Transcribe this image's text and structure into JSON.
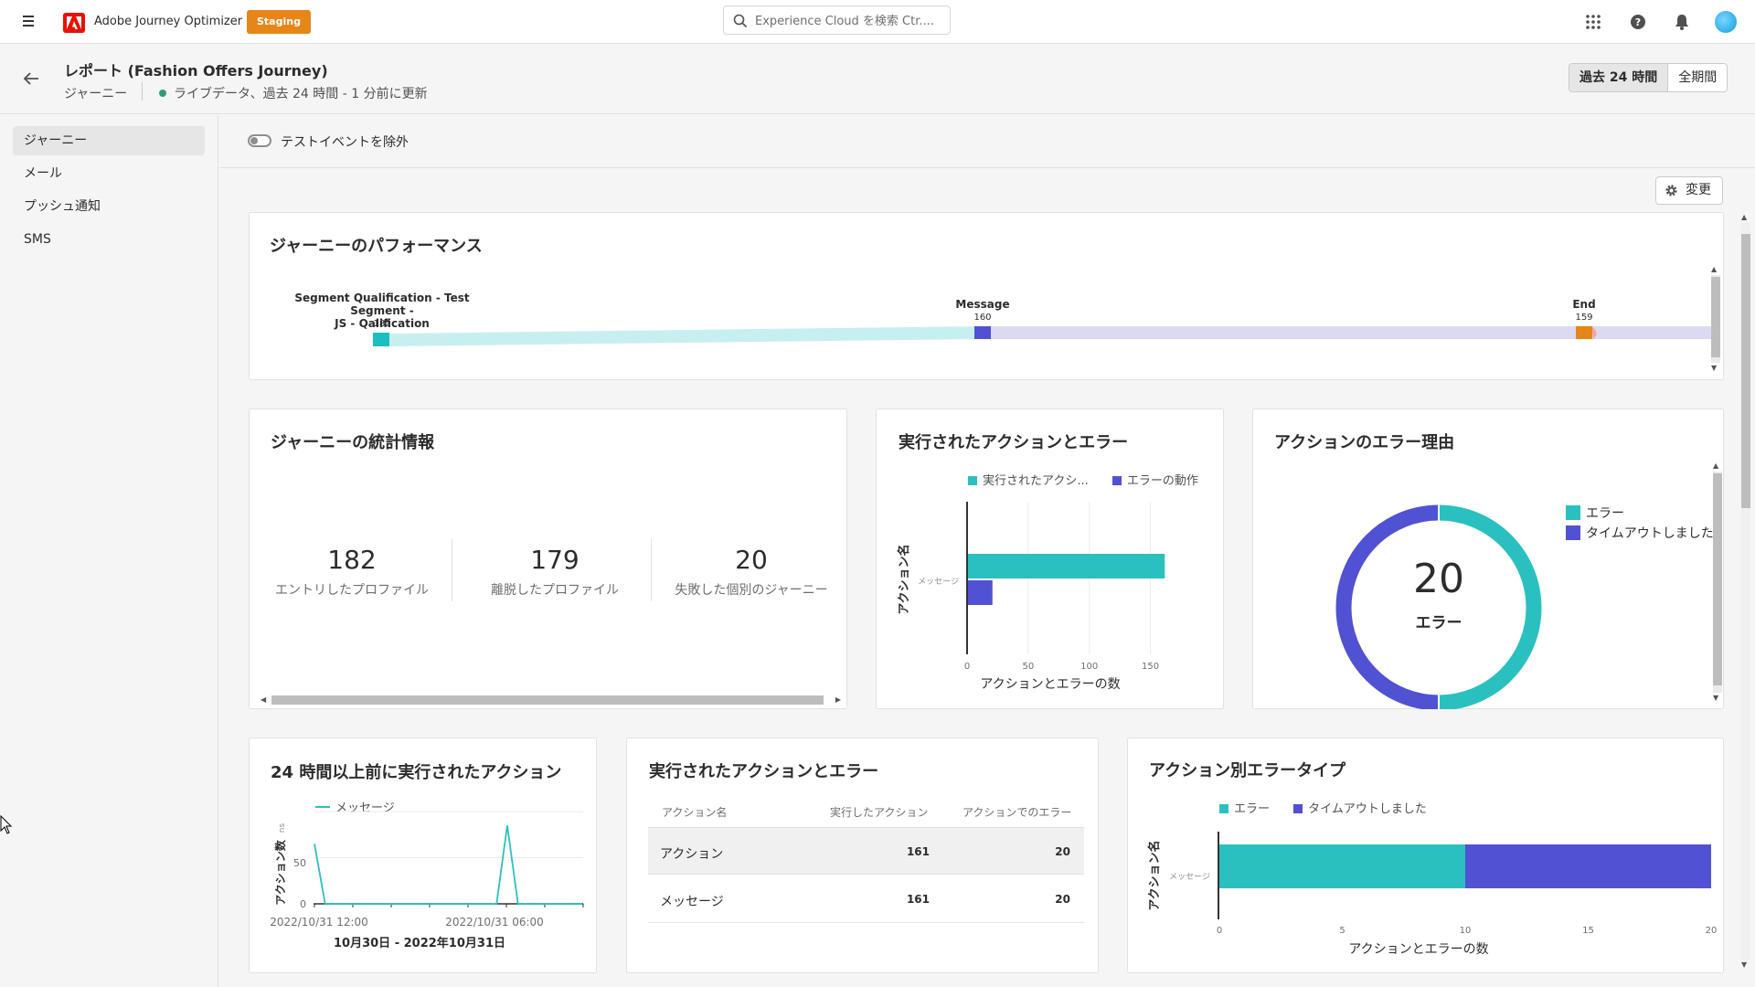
{
  "app": {
    "name": "Adobe Journey Optimizer",
    "env_badge": "Staging",
    "search_placeholder": "Experience Cloud を検索 Ctr...."
  },
  "header": {
    "title": "レポート (Fashion Offers Journey)",
    "breadcrumb": "ジャーニー",
    "live_status": "ライブデータ、過去 24 時間 - 1 分前に更新",
    "range_buttons": [
      "過去 24 時間",
      "全期間"
    ]
  },
  "nav": {
    "items": [
      "ジャーニー",
      "メール",
      "プッシュ通知",
      "SMS"
    ]
  },
  "filter": {
    "toggle_label": "テストイベントを除外",
    "change_button": "変更"
  },
  "performance": {
    "title": "ジャーニーのパフォーマンス",
    "nodes": [
      {
        "label_line1": "Segment Qualification - Test Segment -",
        "label_line2": "JS - Qalification",
        "count": "182",
        "color": "#1bbfbf"
      },
      {
        "label_line1": "Message",
        "label_line2": "",
        "count": "160",
        "color": "#5151d3"
      },
      {
        "label_line1": "End",
        "label_line2": "",
        "count": "159",
        "color": "#e68619"
      }
    ]
  },
  "journey_stats": {
    "title": "ジャーニーの統計情報",
    "stats": [
      {
        "value": "182",
        "label": "エントリしたプロファイル"
      },
      {
        "value": "179",
        "label": "離脱したプロファイル"
      },
      {
        "value": "20",
        "label": "失敗した個別のジャーニー"
      }
    ]
  },
  "actions_errors_chart": {
    "title": "実行されたアクションとエラー",
    "legend": [
      "実行されたアクシ...",
      "エラーの動作"
    ],
    "ylabel": "アクション名",
    "category": "メッセージ",
    "xlabel": "アクションとエラーの数",
    "ticks": [
      "0",
      "50",
      "100",
      "150"
    ]
  },
  "error_reasons": {
    "title": "アクションのエラー理由",
    "center_value": "20",
    "center_label": "エラー",
    "legend": [
      "エラー",
      "タイムアウトしました"
    ]
  },
  "actions_24h": {
    "title": "24 時間以上前に実行されたアクション",
    "legend": "メッセージ",
    "ylabel": "アクション数",
    "yticks": [
      "50",
      "0"
    ],
    "xticks": [
      "2022/10/31 12:00",
      "2022/10/31 06:00"
    ],
    "xlabel": "10月30日 - 2022年10月31日"
  },
  "actions_table": {
    "title": "実行されたアクションとエラー",
    "columns": [
      "アクション名",
      "実行したアクション",
      "アクションでのエラー"
    ],
    "rows": [
      {
        "name": "アクション",
        "executed": "161",
        "errors": "20"
      },
      {
        "name": "メッセージ",
        "executed": "161",
        "errors": "20"
      }
    ]
  },
  "error_types": {
    "title": "アクション別エラータイプ",
    "legend": [
      "エラー",
      "タイムアウトしました"
    ],
    "ylabel": "アクション名",
    "category": "メッセージ",
    "xlabel": "アクションとエラーの数",
    "ticks": [
      "0",
      "5",
      "10",
      "15",
      "20"
    ]
  },
  "colors": {
    "teal": "#2bc0c0",
    "indigo": "#5151d3",
    "orange": "#e68619",
    "staging": "#e68619"
  },
  "chart_data": [
    {
      "type": "bar",
      "title": "実行されたアクションとエラー",
      "categories": [
        "メッセージ"
      ],
      "series": [
        {
          "name": "実行されたアクシ...",
          "values": [
            161
          ]
        },
        {
          "name": "エラーの動作",
          "values": [
            20
          ]
        }
      ],
      "xlabel": "アクションとエラーの数",
      "ylabel": "アクション名",
      "xlim": [
        0,
        175
      ]
    },
    {
      "type": "pie",
      "title": "アクションのエラー理由",
      "categories": [
        "エラー",
        "タイムアウトしました"
      ],
      "values": [
        10,
        10
      ]
    },
    {
      "type": "line",
      "title": "24 時間以上前に実行されたアクション",
      "series": [
        {
          "name": "メッセージ",
          "values": [
            65,
            0,
            0,
            0,
            0,
            0,
            0,
            0,
            0,
            0,
            0,
            0,
            0,
            0,
            0,
            0,
            0,
            0,
            85,
            0,
            0,
            0,
            0,
            0,
            0,
            0
          ]
        }
      ],
      "xlabel": "10月30日 - 2022年10月31日",
      "ylabel": "アクション数",
      "ylim": [
        0,
        110
      ]
    },
    {
      "type": "bar",
      "title": "アクション別エラータイプ",
      "stacked": true,
      "categories": [
        "メッセージ"
      ],
      "series": [
        {
          "name": "エラー",
          "values": [
            10
          ]
        },
        {
          "name": "タイムアウトしました",
          "values": [
            10
          ]
        }
      ],
      "xlabel": "アクションとエラーの数",
      "ylabel": "アクション名",
      "xlim": [
        0,
        20
      ]
    }
  ]
}
